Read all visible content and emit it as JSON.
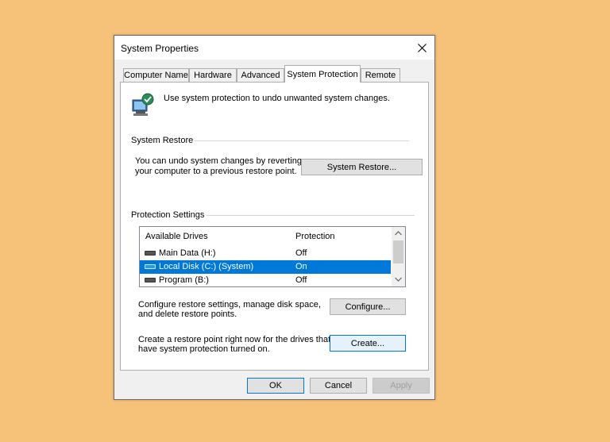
{
  "window": {
    "title": "System Properties"
  },
  "tabs": [
    "Computer Name",
    "Hardware",
    "Advanced",
    "System Protection",
    "Remote"
  ],
  "header": {
    "description": "Use system protection to undo unwanted system changes."
  },
  "system_restore": {
    "group_label": "System Restore",
    "description_line1": "You can undo system changes by reverting",
    "description_line2": "your computer to a previous restore point.",
    "button_label": "System Restore..."
  },
  "protection_settings": {
    "group_label": "Protection Settings",
    "columns": [
      "Available Drives",
      "Protection"
    ],
    "drives": [
      {
        "name": "Main Data (H:)",
        "protection": "Off",
        "selected": false
      },
      {
        "name": "Local Disk (C:) (System)",
        "protection": "On",
        "selected": true
      },
      {
        "name": "Program (B:)",
        "protection": "Off",
        "selected": false
      }
    ],
    "configure_text_line1": "Configure restore settings, manage disk space,",
    "configure_text_line2": "and delete restore points.",
    "configure_button": "Configure...",
    "create_text_line1": "Create a restore point right now for the drives that",
    "create_text_line2": "have system protection turned on.",
    "create_button": "Create..."
  },
  "footer": {
    "ok": "OK",
    "cancel": "Cancel",
    "apply": "Apply"
  },
  "colors": {
    "background": "#f6c27a",
    "selection": "#0078d7",
    "focus_border": "#0078d7"
  },
  "icons": {
    "close": "close-icon",
    "header": "system-protection-icon",
    "drive": "drive-icon",
    "system_drive": "system-drive-icon"
  }
}
